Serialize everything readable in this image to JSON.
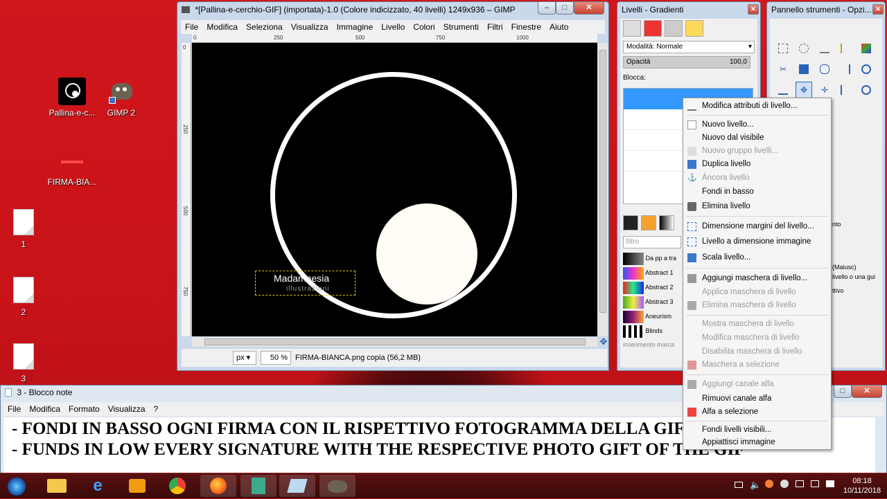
{
  "desktop": {
    "icons": [
      {
        "label": "Pallina-e-c..."
      },
      {
        "label": "GIMP 2"
      },
      {
        "label": "FIRMA-BIA..."
      },
      {
        "label": "1"
      },
      {
        "label": "2"
      },
      {
        "label": "3"
      }
    ]
  },
  "gimp": {
    "title": "*[Pallina-e-cerchio-GIF] (importata)-1.0 (Colore indicizzato, 40 livelli) 1249x936 – GIMP",
    "menu": [
      "File",
      "Modifica",
      "Seleziona",
      "Visualizza",
      "Immagine",
      "Livello",
      "Colori",
      "Strumenti",
      "Filtri",
      "Finestre",
      "Aiuto"
    ],
    "ruler_h": [
      "0",
      "250",
      "500",
      "750",
      "1000"
    ],
    "ruler_v": [
      "0",
      "250",
      "500",
      "750"
    ],
    "signature_line1": "Madamnesia",
    "signature_line2": "illustrazioni",
    "status_unit": "px",
    "status_zoom": "50 %",
    "status_text": "FIRMA-BIANCA.png copia (56,2 MB)"
  },
  "layers": {
    "title": "Livelli - Gradienti",
    "mode_label": "Modalità: Normale",
    "opacity_label": "Opacità",
    "opacity_value": "100,0",
    "lock_label": "Blocca:",
    "filter_placeholder": "filtro",
    "gradients": [
      {
        "name": "Da pp a tra"
      },
      {
        "name": "Abstract 1"
      },
      {
        "name": "Abstract 2"
      },
      {
        "name": "Abstract 3"
      },
      {
        "name": "Aneurism"
      },
      {
        "name": "Blinds"
      }
    ],
    "tag_placeholder": "inserimento marca"
  },
  "toolbox": {
    "title": "Pannello strumenti - Opzi...",
    "side_texts": [
      "nto",
      "(Maiusc)",
      "livello o una gui",
      "ttivo"
    ]
  },
  "context_menu": {
    "items": [
      {
        "label": "Modifica attributi di livello...",
        "enabled": true
      },
      {
        "label": "Nuovo livello...",
        "enabled": true
      },
      {
        "label": "Nuovo dal visibile",
        "enabled": true
      },
      {
        "label": "Nuovo gruppo livelli...",
        "enabled": false
      },
      {
        "label": "Duplica livello",
        "enabled": true
      },
      {
        "label": "Àncora livello",
        "enabled": false
      },
      {
        "label": "Fondi in basso",
        "enabled": true
      },
      {
        "label": "Elimina livello",
        "enabled": true
      },
      {
        "label": "Dimensione margini del livello...",
        "enabled": true
      },
      {
        "label": "Livello a dimensione immagine",
        "enabled": true
      },
      {
        "label": "Scala livello...",
        "enabled": true
      },
      {
        "label": "Aggiungi maschera di livello...",
        "enabled": true
      },
      {
        "label": "Applica maschera di livello",
        "enabled": false
      },
      {
        "label": "Elimina maschera di livello",
        "enabled": false
      },
      {
        "label": "Mostra maschera di livello",
        "enabled": false
      },
      {
        "label": "Modifica maschera di livello",
        "enabled": false
      },
      {
        "label": "Disabilita maschera di livello",
        "enabled": false
      },
      {
        "label": "Maschera a selezione",
        "enabled": false
      },
      {
        "label": "Aggiungi canale alfa",
        "enabled": false
      },
      {
        "label": "Rimuovi canale alfa",
        "enabled": true
      },
      {
        "label": "Alfa a selezione",
        "enabled": true
      },
      {
        "label": "Fondi livelli visibili...",
        "enabled": true
      },
      {
        "label": "Appiattisci immagine",
        "enabled": true
      }
    ]
  },
  "notepad": {
    "title": "3 - Blocco note",
    "menu": [
      "File",
      "Modifica",
      "Formato",
      "Visualizza",
      "?"
    ],
    "line1": "- FONDI IN BASSO OGNI FIRMA CON IL RISPETTIVO FOTOGRAMMA DELLA GIF",
    "line2": "- FUNDS IN LOW EVERY SIGNATURE WITH THE RESPECTIVE PHOTO GIFT OF THE GIF"
  },
  "taskbar": {
    "time": "08:18",
    "date": "10/11/2018"
  }
}
